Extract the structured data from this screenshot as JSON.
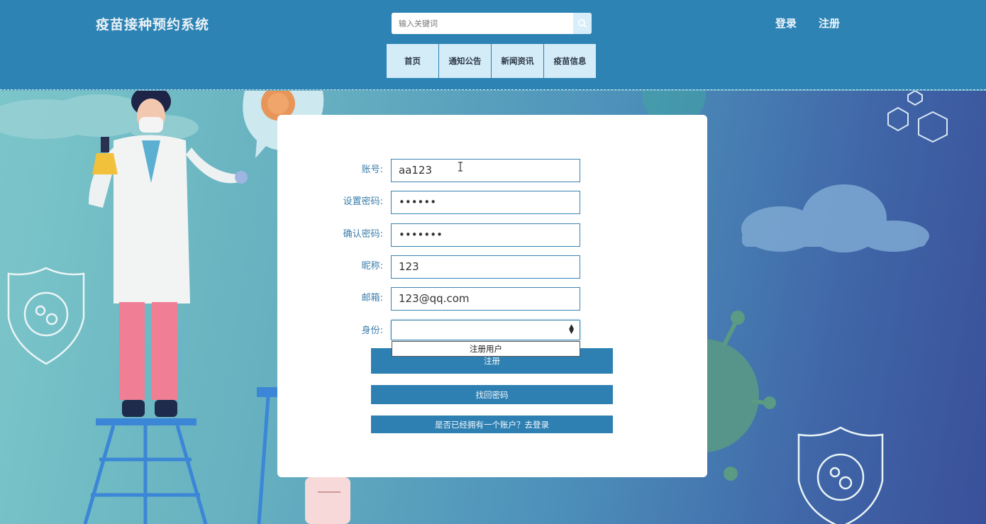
{
  "header": {
    "brand": "疫苗接种预约系统",
    "search": {
      "placeholder": "输入关键词",
      "icon": "search-icon"
    },
    "links": {
      "login": "登录",
      "register": "注册"
    },
    "nav": [
      {
        "label": "首页"
      },
      {
        "label": "通知公告"
      },
      {
        "label": "新闻资讯"
      },
      {
        "label": "疫苗信息"
      }
    ]
  },
  "form": {
    "fields": {
      "account": {
        "label": "账号:",
        "value": "aa123"
      },
      "password": {
        "label": "设置密码:",
        "value": "••••••"
      },
      "confirm": {
        "label": "确认密码:",
        "value": "•••••••"
      },
      "nickname": {
        "label": "昵称:",
        "value": "123"
      },
      "email": {
        "label": "邮箱:",
        "value": "123@qq.com"
      },
      "identity": {
        "label": "身份:",
        "value": "",
        "options": [
          "注册用户"
        ]
      }
    },
    "buttons": {
      "register": "注册",
      "recover": "找回密码",
      "to_login": "是否已经拥有一个账户？去登录"
    }
  },
  "colors": {
    "header_bg": "#2c83b4",
    "nav_bg": "#d4ebf8",
    "button_bg": "#2e80b3",
    "label_color": "#3b7eab"
  }
}
